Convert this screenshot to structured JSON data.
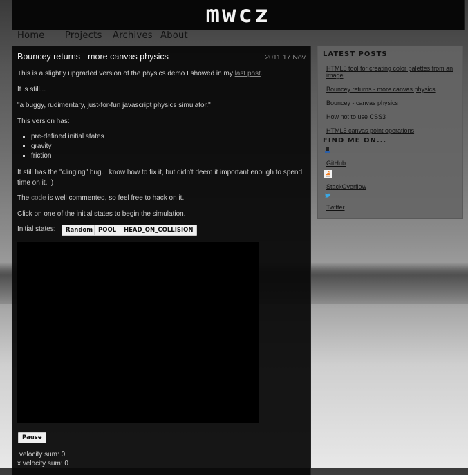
{
  "site": {
    "logo": "mwcz"
  },
  "nav": [
    "Home",
    "Projects",
    "Archives",
    "About"
  ],
  "post": {
    "title": "Bouncey returns - more canvas physics",
    "date": "2011 17 Nov",
    "intro_before": "This is a slightly upgraded version of the physics demo I showed in my ",
    "intro_link": "last post",
    "intro_after": ".",
    "still": "It is still...",
    "quote": "\"a buggy, rudimentary, just-for-fun javascript physics simulator.\"",
    "has": "This version has:",
    "features": [
      "pre-defined initial states",
      "gravity",
      "friction"
    ],
    "bug": "It still has the \"clinging\" bug. I know how to fix it, but didn't deem it important enough to spend time on it. :)",
    "code_before": "The ",
    "code_link": "code",
    "code_after": " is well commented, so feel free to hack on it.",
    "click": "Click on one of the initial states to begin the simulation.",
    "states_label": "Initial states:",
    "states": [
      "Random",
      "POOL",
      "HEAD_ON_COLLISION"
    ],
    "pause_label": "Pause",
    "velocity_sum": "velocity sum: 0",
    "x_velocity_sum": "x velocity sum: 0"
  },
  "sidebar": {
    "latest_heading": "LATEST POSTS",
    "latest": [
      "HTML5 tool for creating color palettes from an image",
      "Bouncey returns - more canvas physics",
      "Bouncey - canvas physics",
      "How not to use CSS3",
      "HTML5 canvas point operations"
    ],
    "find_heading": "FIND ME ON...",
    "profiles": [
      {
        "label": "GitHub",
        "icon": "github-icon"
      },
      {
        "label": "StackOverflow",
        "icon": "stackoverflow-icon"
      },
      {
        "label": "Twitter",
        "icon": "twitter-icon"
      }
    ]
  },
  "colors": {
    "accent_twitter": "#3aa9e6",
    "stackoverflow_orange": "#f48024"
  }
}
